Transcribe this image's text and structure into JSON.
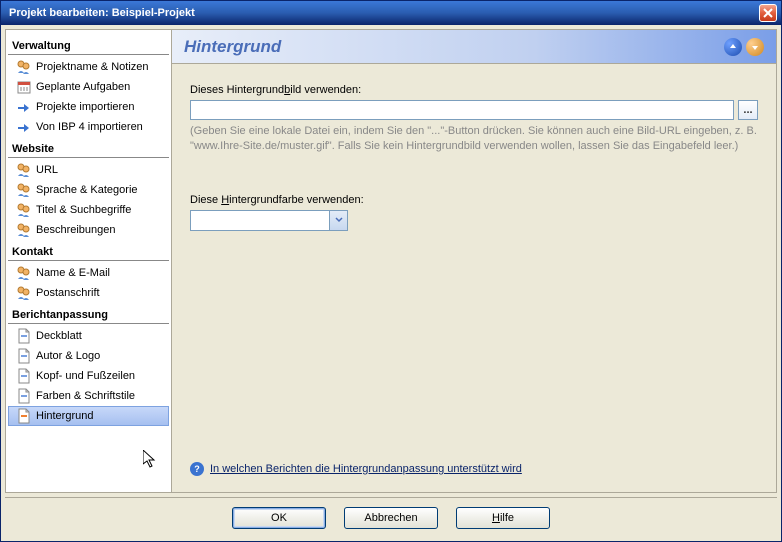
{
  "window": {
    "title": "Projekt bearbeiten: Beispiel-Projekt"
  },
  "sidebar": {
    "cats": [
      {
        "title": "Verwaltung",
        "items": [
          {
            "label": "Projektname & Notizen",
            "icon": "users"
          },
          {
            "label": "Geplante Aufgaben",
            "icon": "calendar"
          },
          {
            "label": "Projekte importieren",
            "icon": "import"
          },
          {
            "label": "Von IBP 4 importieren",
            "icon": "import"
          }
        ]
      },
      {
        "title": "Website",
        "items": [
          {
            "label": "URL",
            "icon": "users"
          },
          {
            "label": "Sprache & Kategorie",
            "icon": "users-lang"
          },
          {
            "label": "Titel & Suchbegriffe",
            "icon": "users-search"
          },
          {
            "label": "Beschreibungen",
            "icon": "users-desc"
          }
        ]
      },
      {
        "title": "Kontakt",
        "items": [
          {
            "label": "Name & E-Mail",
            "icon": "users-mail"
          },
          {
            "label": "Postanschrift",
            "icon": "users-post"
          }
        ]
      },
      {
        "title": "Berichtanpassung",
        "items": [
          {
            "label": "Deckblatt",
            "icon": "page"
          },
          {
            "label": "Autor & Logo",
            "icon": "page"
          },
          {
            "label": "Kopf- und Fußzeilen",
            "icon": "page"
          },
          {
            "label": "Farben & Schriftstile",
            "icon": "page"
          },
          {
            "label": "Hintergrund",
            "icon": "page-orange",
            "selected": true
          }
        ]
      }
    ]
  },
  "main": {
    "title": "Hintergrund",
    "bgimage_label_pre": "Dieses Hintergrund",
    "bgimage_label_u": "b",
    "bgimage_label_post": "ild verwenden:",
    "bgimage_value": "",
    "browse_label": "...",
    "hint": "(Geben Sie eine lokale Datei ein, indem Sie den \"...\"-Button drücken. Sie können auch eine Bild-URL eingeben, z. B. \"www.Ihre-Site.de/muster.gif\". Falls Sie kein Hintergrundbild verwenden wollen, lassen Sie das Eingabefeld leer.)",
    "bgcolor_label_pre": "Diese ",
    "bgcolor_label_u": "H",
    "bgcolor_label_post": "intergrundfarbe verwenden:",
    "bgcolor_value": "#ffffff",
    "help_link": "In welchen Berichten die Hintergrundanpassung unterstützt wird"
  },
  "buttons": {
    "ok": "OK",
    "cancel": "Abbrechen",
    "help_pre": "",
    "help_u": "H",
    "help_post": "ilfe"
  }
}
